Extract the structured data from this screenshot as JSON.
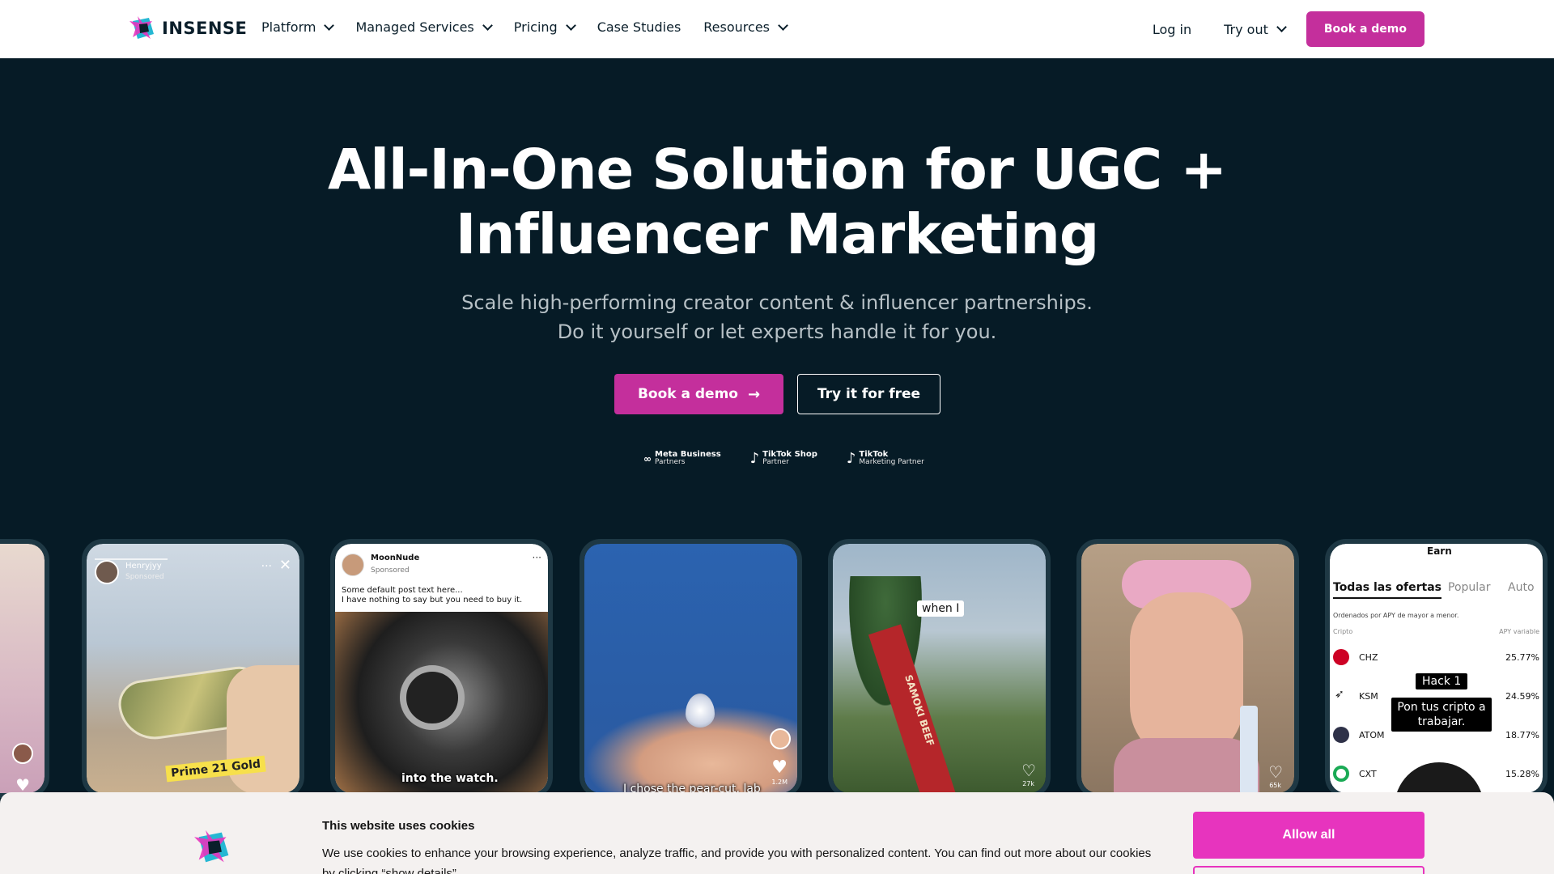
{
  "nav": {
    "brand": "INSENSE",
    "links": [
      "Platform",
      "Managed Services",
      "Pricing",
      "Case Studies",
      "Resources"
    ],
    "login": "Log in",
    "try_out": "Try out",
    "book_demo": "Book a demo"
  },
  "hero": {
    "title_line1": "All-In-One Solution for UGC +",
    "title_line2": "Influencer Marketing",
    "subtitle_line1": "Scale high-performing creator content & influencer partnerships.",
    "subtitle_line2": "Do it yourself or let experts handle it for you.",
    "cta_primary": "Book a demo",
    "cta_secondary": "Try it for free"
  },
  "partners": [
    {
      "main": "Meta Business",
      "sub": "Partners"
    },
    {
      "main": "TikTok Shop",
      "sub": "Partner"
    },
    {
      "main": "TikTok",
      "sub": "Marketing Partner"
    }
  ],
  "cards": {
    "card2": {
      "user": "Henryjyy",
      "tag": "Sponsored",
      "caption": "Prime 21 Gold"
    },
    "card3": {
      "user": "MoonNude",
      "tag": "Sponsored",
      "post_text": "Some default post text here...",
      "post_text2": "I have nothing to say but you need to buy it.",
      "caption": "into the watch."
    },
    "card4": {
      "caption": "I chose the pear-cut, lab",
      "likes": "1.2M"
    },
    "card5": {
      "label": "when I",
      "likes": "27k",
      "product": "SAMOKI BEEF"
    },
    "card6": {
      "likes": "65k"
    },
    "card7": {
      "header": "Earn",
      "tabs": [
        "Todas las ofertas",
        "Popular",
        "Auto"
      ],
      "sort_note": "Ordenados por APY de mayor a menor.",
      "col_left": "Cripto",
      "col_right": "APY variable",
      "rows": [
        {
          "sym": "CHZ",
          "apy": "25.77%"
        },
        {
          "sym": "KSM",
          "apy": "24.59%"
        },
        {
          "sym": "ATOM",
          "apy": "18.77%"
        },
        {
          "sym": "CXT",
          "apy": "15.28%"
        }
      ],
      "hack_label": "Hack 1",
      "hack_text": "Pon tus cripto a trabajar."
    }
  },
  "cookie": {
    "title": "This website uses cookies",
    "text": "We use cookies to enhance your browsing experience, analyze traffic, and provide you with personalized content. You can find out more about our cookies by clicking “show details”.",
    "allow_all": "Allow all"
  },
  "colors": {
    "brand_pink": "#c42f9c",
    "background": "#061b26",
    "cookie_button": "#e734be"
  }
}
